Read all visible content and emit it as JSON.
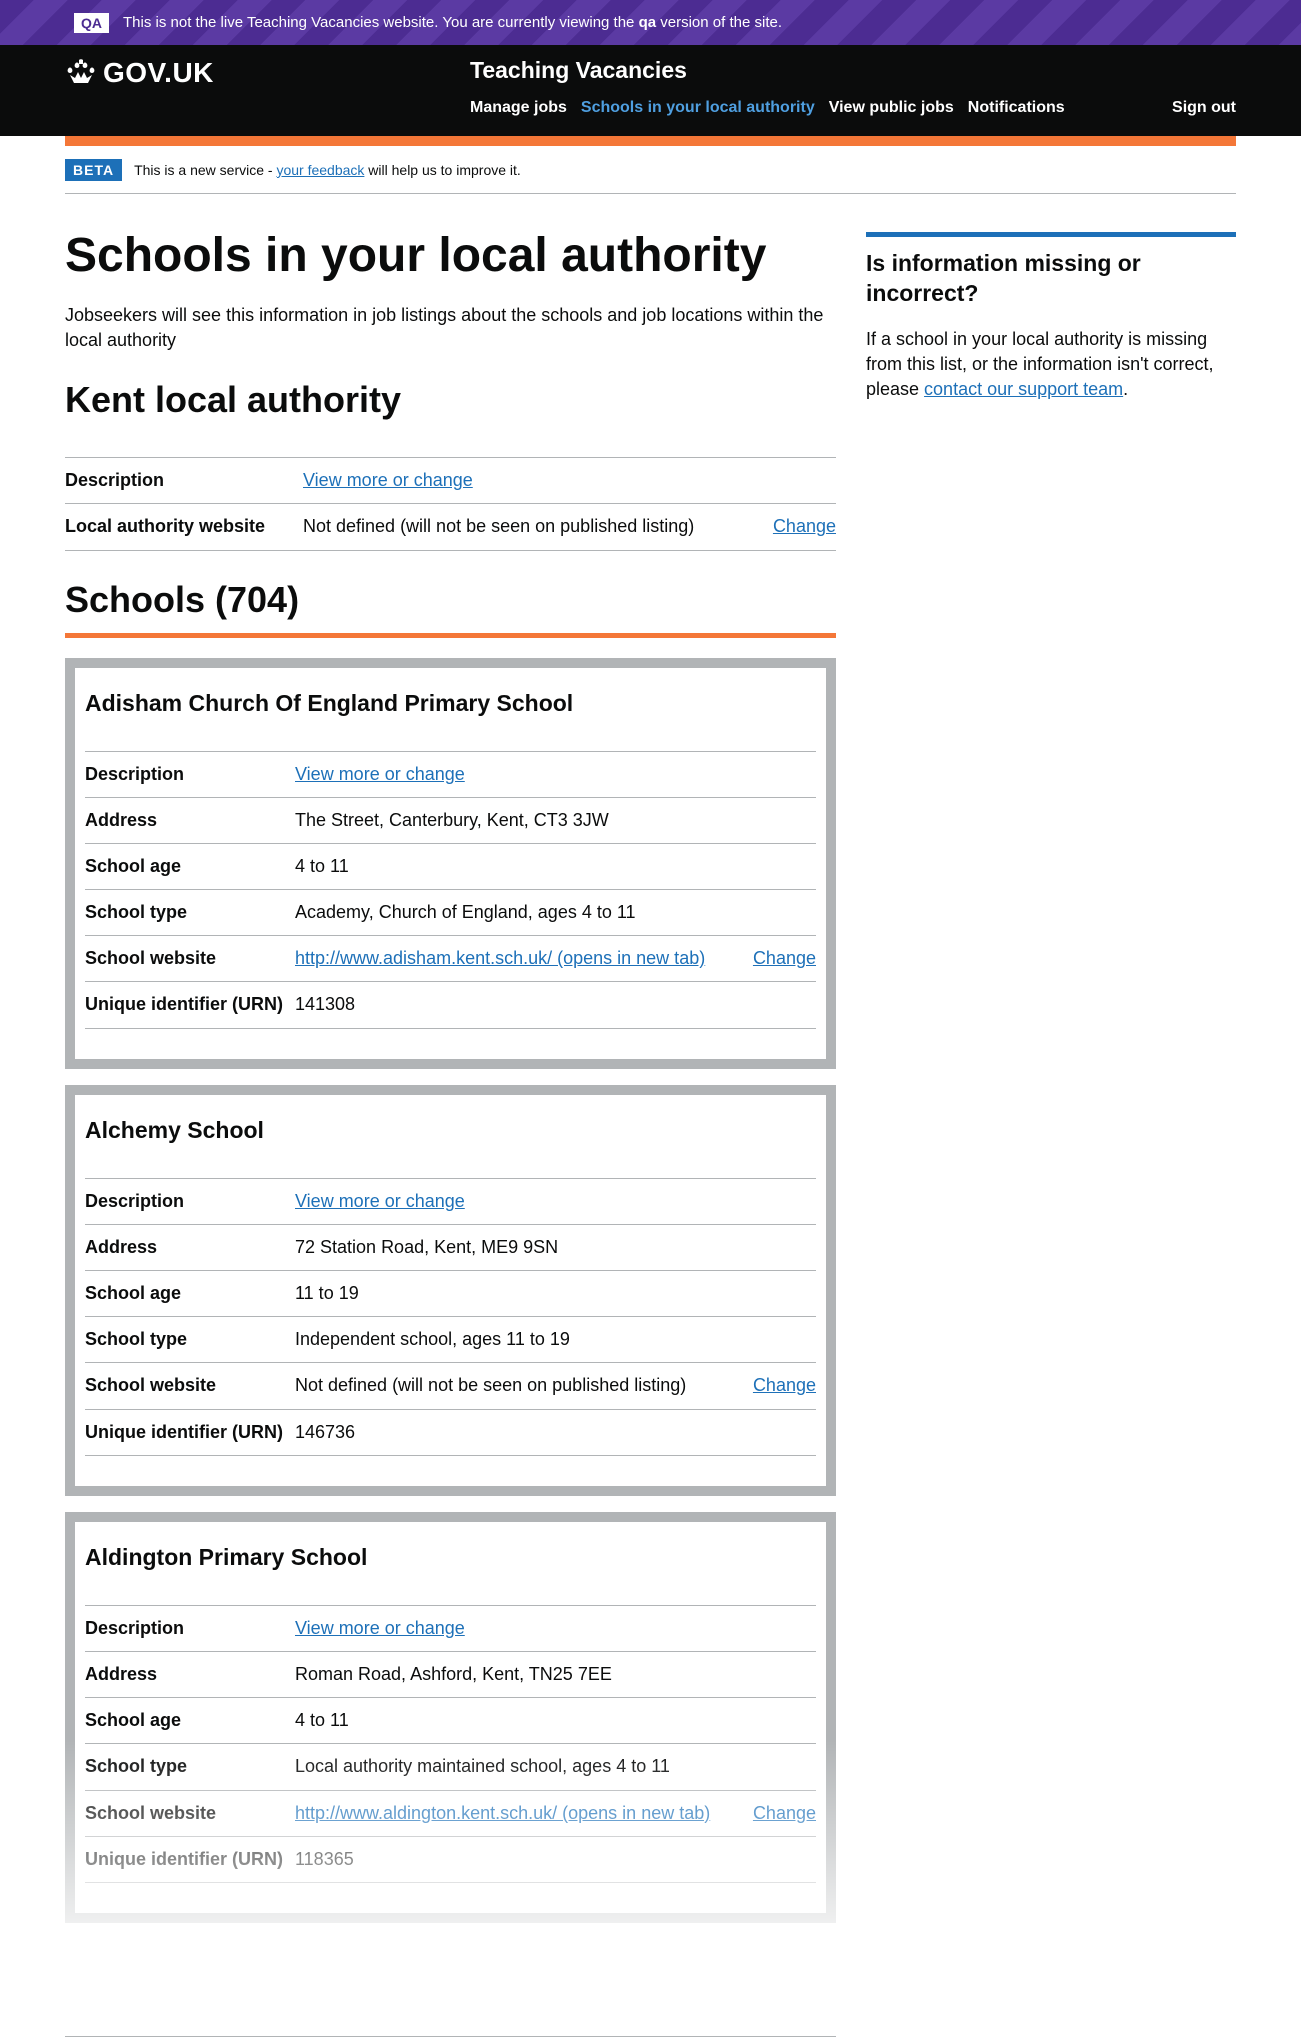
{
  "qa_banner": {
    "tag": "QA",
    "text_before": "This is not the live Teaching Vacancies website. You are currently viewing the ",
    "bold": "qa",
    "text_after": " version of the site."
  },
  "header": {
    "logo": "GOV.UK",
    "service_name": "Teaching Vacancies",
    "nav": [
      "Manage jobs",
      "Schools in your local authority",
      "View public jobs",
      "Notifications"
    ],
    "sign_out": "Sign out"
  },
  "beta": {
    "tag": "BETA",
    "before": "This is a new service - ",
    "link": "your feedback",
    "after": " will help us to improve it."
  },
  "page": {
    "title": "Schools in your local authority",
    "lead": "Jobseekers will see this information in job listings about the schools and job locations within the local authority",
    "la_heading": "Kent local authority",
    "la_rows": [
      {
        "key": "Description",
        "value": "View more or change",
        "value_is_link": true,
        "action": ""
      },
      {
        "key": "Local authority website",
        "value": "Not defined (will not be seen on published listing)",
        "value_is_link": false,
        "action": "Change"
      }
    ],
    "schools_heading": "Schools (704)"
  },
  "aside": {
    "title": "Is information missing or incorrect?",
    "text": "If a school in your local authority is missing from this list, or the information isn't correct, please ",
    "link": "contact our support team",
    "end": "."
  },
  "schools": [
    {
      "name": "Adisham Church Of England Primary School",
      "rows": [
        {
          "key": "Description",
          "value": "View more or change",
          "link": true,
          "action": ""
        },
        {
          "key": "Address",
          "value": "The Street, Canterbury, Kent, CT3 3JW",
          "link": false,
          "action": ""
        },
        {
          "key": "School age",
          "value": "4 to 11",
          "link": false,
          "action": ""
        },
        {
          "key": "School type",
          "value": "Academy, Church of England, ages 4 to 11",
          "link": false,
          "action": ""
        },
        {
          "key": "School website",
          "value": "http://www.adisham.kent.sch.uk/ (opens in new tab)",
          "link": true,
          "action": "Change"
        },
        {
          "key": "Unique identifier (URN)",
          "value": "141308",
          "link": false,
          "action": ""
        }
      ]
    },
    {
      "name": "Alchemy School",
      "rows": [
        {
          "key": "Description",
          "value": "View more or change",
          "link": true,
          "action": ""
        },
        {
          "key": "Address",
          "value": "72 Station Road, Kent, ME9 9SN",
          "link": false,
          "action": ""
        },
        {
          "key": "School age",
          "value": "11 to 19",
          "link": false,
          "action": ""
        },
        {
          "key": "School type",
          "value": "Independent school, ages 11 to 19",
          "link": false,
          "action": ""
        },
        {
          "key": "School website",
          "value": "Not defined (will not be seen on published listing)",
          "link": false,
          "action": "Change"
        },
        {
          "key": "Unique identifier (URN)",
          "value": "146736",
          "link": false,
          "action": ""
        }
      ]
    },
    {
      "name": "Aldington Primary School",
      "rows": [
        {
          "key": "Description",
          "value": "View more or change",
          "link": true,
          "action": ""
        },
        {
          "key": "Address",
          "value": "Roman Road, Ashford, Kent, TN25 7EE",
          "link": false,
          "action": ""
        },
        {
          "key": "School age",
          "value": "4 to 11",
          "link": false,
          "action": ""
        },
        {
          "key": "School type",
          "value": "Local authority maintained school, ages 4 to 11",
          "link": false,
          "action": ""
        },
        {
          "key": "School website",
          "value": "http://www.aldington.kent.sch.uk/ (opens in new tab)",
          "link": true,
          "action": "Change"
        },
        {
          "key": "Unique identifier (URN)",
          "value": "118365",
          "link": false,
          "action": ""
        }
      ]
    }
  ]
}
